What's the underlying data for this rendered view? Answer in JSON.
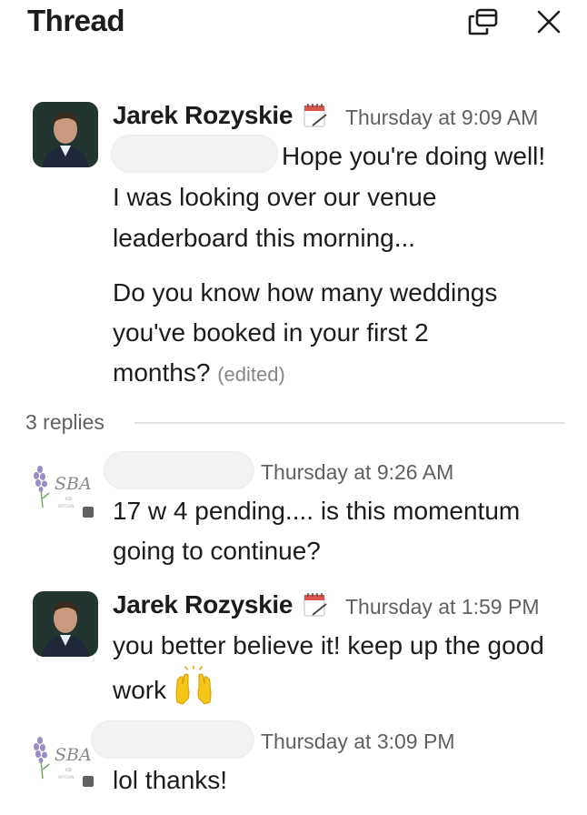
{
  "header": {
    "title": "Thread",
    "popout_icon": "popout-window-icon",
    "close_icon": "close-icon"
  },
  "parent_message": {
    "author": "Jarek Rozyskie",
    "status_emoji": "calendar-icon",
    "timestamp": "Thursday at 9:09 AM",
    "line1": "Hope you're doing well!",
    "line2": "I was looking over our venue",
    "line3": "leaderboard this morning...",
    "line4": "Do you know how many weddings",
    "line5": "you've booked in your first 2",
    "line6": "months?",
    "edited": "(edited)"
  },
  "replies_label": "3 replies",
  "replies": [
    {
      "avatar_text": "SBA",
      "timestamp": "Thursday at 9:26 AM",
      "line1": "17 w 4 pending.... is this momentum",
      "line2": "going to continue?"
    },
    {
      "author": "Jarek Rozyskie",
      "status_emoji": "calendar-icon",
      "timestamp": "Thursday at 1:59 PM",
      "line1": "you better believe it! keep up the good",
      "line2": "work",
      "emoji": "raised-hands-icon"
    },
    {
      "avatar_text": "SBA",
      "timestamp": "Thursday at 3:09 PM",
      "line1": "lol thanks!"
    }
  ],
  "colors": {
    "text": "#1d1c1d",
    "muted": "#616061",
    "divider": "#e0e0e0",
    "redacted": "#f2f2f3"
  }
}
